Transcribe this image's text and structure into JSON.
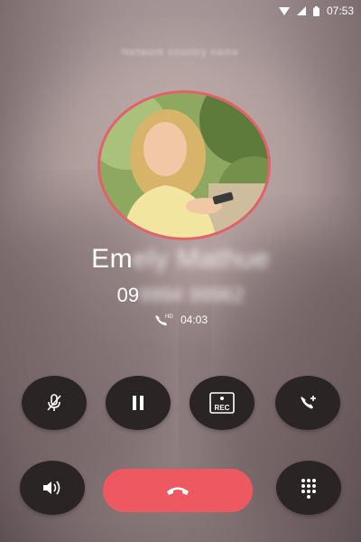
{
  "status_bar": {
    "time": "07:53",
    "icons": [
      "wifi-icon",
      "signal-icon",
      "battery-icon"
    ]
  },
  "caller": {
    "carrier_text": "Network country name",
    "name_visible": "Em",
    "name_blurred": "ely Mathue",
    "number_visible": "09",
    "number_blurred": "9994 99962",
    "call_type_badge": "HD",
    "duration": "04:03"
  },
  "controls": {
    "mute": "mute-icon",
    "hold": "pause-icon",
    "record": "REC",
    "add_call": "add-call-icon",
    "speaker": "speaker-icon",
    "end_call": "end-call-icon",
    "keypad": "keypad-icon"
  },
  "colors": {
    "accent": "#ee5961",
    "avatar_ring": "#e5606b",
    "button_bg": "#2a2424"
  }
}
